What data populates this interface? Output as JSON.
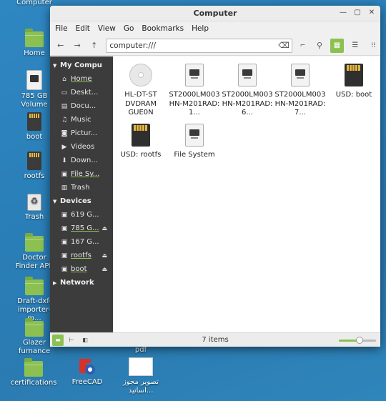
{
  "desktop": {
    "icons": [
      {
        "label": "Computer"
      },
      {
        "label": "Home"
      },
      {
        "label": "785 GB Volume"
      },
      {
        "label": "boot"
      },
      {
        "label": "rootfs"
      },
      {
        "label": "Trash"
      },
      {
        "label": "Doctor Finder APP"
      },
      {
        "label": "Draft-dxf-importer-m..."
      },
      {
        "label": "Glazer furnance"
      },
      {
        "label": "certifications"
      },
      {
        "label": "FreeCAD"
      },
      {
        "label": "pdf"
      },
      {
        "label": "تصویر مجوز اساتید..."
      }
    ]
  },
  "window": {
    "title": "Computer",
    "menu": [
      "File",
      "Edit",
      "View",
      "Go",
      "Bookmarks",
      "Help"
    ],
    "address": "computer:///",
    "sidebar": {
      "sections": [
        {
          "title": "My Compu",
          "items": [
            {
              "label": "Home",
              "icon": "home-icon",
              "glyph": "⌂"
            },
            {
              "label": "Deskt...",
              "icon": "desktop-icon",
              "glyph": "▭"
            },
            {
              "label": "Docu...",
              "icon": "document-icon",
              "glyph": "▤"
            },
            {
              "label": "Music",
              "icon": "music-icon",
              "glyph": "♫"
            },
            {
              "label": "Pictur...",
              "icon": "camera-icon",
              "glyph": "◙"
            },
            {
              "label": "Videos",
              "icon": "video-icon",
              "glyph": "▶"
            },
            {
              "label": "Down...",
              "icon": "download-icon",
              "glyph": "⬇"
            },
            {
              "label": "File Sy...",
              "icon": "drive-icon",
              "glyph": "▣"
            },
            {
              "label": "Trash",
              "icon": "trash-icon",
              "glyph": "🗑"
            }
          ]
        },
        {
          "title": "Devices",
          "items": [
            {
              "label": "619 G...",
              "icon": "drive-icon",
              "glyph": "▣"
            },
            {
              "label": "785 G...",
              "icon": "drive-icon",
              "glyph": "▣",
              "eject": true
            },
            {
              "label": "167 G...",
              "icon": "drive-icon",
              "glyph": "▣"
            },
            {
              "label": "rootfs",
              "icon": "drive-icon",
              "glyph": "▣",
              "eject": true
            },
            {
              "label": "boot",
              "icon": "drive-icon",
              "glyph": "▣",
              "eject": true
            }
          ]
        },
        {
          "title": "Network",
          "items": []
        }
      ]
    },
    "files": [
      {
        "label": "HL-DT-ST DVDRAM GUE0N",
        "type": "disc"
      },
      {
        "label": "ST2000LM003 HN-M201RAD: 1...",
        "type": "hdd"
      },
      {
        "label": "ST2000LM003 HN-M201RAD: 6...",
        "type": "hdd"
      },
      {
        "label": "ST2000LM003 HN-M201RAD: 7...",
        "type": "hdd"
      },
      {
        "label": "USD: boot",
        "type": "sd"
      },
      {
        "label": "USD: rootfs",
        "type": "sd"
      },
      {
        "label": "File System",
        "type": "hdd"
      }
    ],
    "status": {
      "item_count": "7 items",
      "zoom_level": 0.55
    },
    "colors": {
      "accent": "#8cc152",
      "sidebar_bg": "#3c3c3c"
    }
  }
}
